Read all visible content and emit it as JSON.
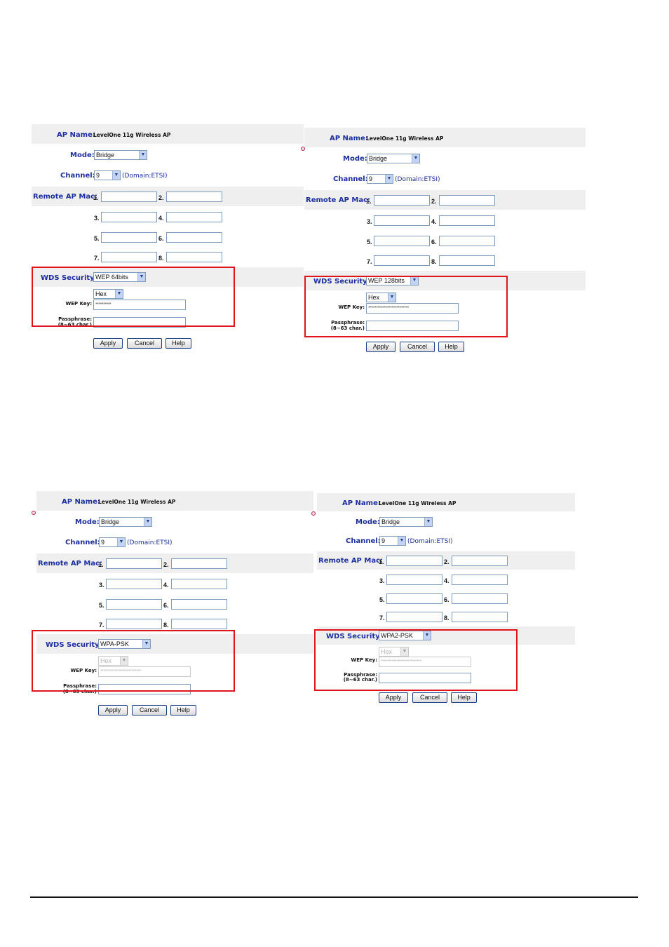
{
  "panels": [
    {
      "ap_name_label": "AP Name:",
      "ap_name": "LevelOne 11g Wireless AP",
      "mode_label": "Mode:",
      "mode": "Bridge",
      "channel_label": "Channel:",
      "channel": "9",
      "domain": "(Domain:ETSI)",
      "remote_label": "Remote AP Mac:",
      "mac_numbers": [
        "1.",
        "2.",
        "3.",
        "4.",
        "5.",
        "6.",
        "7.",
        "8."
      ],
      "security_label": "WDS Security:",
      "security": "WEP 64bits",
      "key_format": "Hex",
      "wep_key_label": "WEP Key:",
      "wep_key": "**********",
      "passphrase_label": "Passphrase:",
      "passphrase_hint": "(8~63 char.)",
      "apply": "Apply",
      "cancel": "Cancel",
      "help": "Help"
    },
    {
      "ap_name_label": "AP Name:",
      "ap_name": "LevelOne 11g Wireless AP",
      "mode_label": "Mode:",
      "mode": "Bridge",
      "channel_label": "Channel:",
      "channel": "9",
      "domain": "(Domain:ETSI)",
      "remote_label": "Remote AP Mac:",
      "mac_numbers": [
        "1.",
        "2.",
        "3.",
        "4.",
        "5.",
        "6.",
        "7.",
        "8."
      ],
      "security_label": "WDS Security:",
      "security": "WEP 128bits",
      "key_format": "Hex",
      "wep_key_label": "WEP Key:",
      "wep_key": "**************************",
      "passphrase_label": "Passphrase:",
      "passphrase_hint": "(8~63 char.)",
      "apply": "Apply",
      "cancel": "Cancel",
      "help": "Help"
    },
    {
      "ap_name_label": "AP Name:",
      "ap_name": "LevelOne 11g Wireless AP",
      "mode_label": "Mode:",
      "mode": "Bridge",
      "channel_label": "Channel:",
      "channel": "9",
      "domain": "(Domain:ETSI)",
      "remote_label": "Remote AP Mac:",
      "mac_numbers": [
        "1.",
        "2.",
        "3.",
        "4.",
        "5.",
        "6.",
        "7.",
        "8."
      ],
      "security_label": "WDS Security:",
      "security": "WPA-PSK",
      "key_format": "Hex",
      "wep_key_label": "WEP Key:",
      "wep_key": "**************************",
      "passphrase_label": "Passphrase:",
      "passphrase_hint": "(8~63 char.)",
      "apply": "Apply",
      "cancel": "Cancel",
      "help": "Help"
    },
    {
      "ap_name_label": "AP Name:",
      "ap_name": "LevelOne 11g Wireless AP",
      "mode_label": "Mode:",
      "mode": "Bridge",
      "channel_label": "Channel:",
      "channel": "9",
      "domain": "(Domain:ETSI)",
      "remote_label": "Remote AP Mac:",
      "mac_numbers": [
        "1.",
        "2.",
        "3.",
        "4.",
        "5.",
        "6.",
        "7.",
        "8."
      ],
      "security_label": "WDS Security:",
      "security": "WPA2-PSK",
      "key_format": "Hex",
      "wep_key_label": "WEP Key:",
      "wep_key": "**************************",
      "passphrase_label": "Passphrase:",
      "passphrase_hint": "(8~63 char.)",
      "apply": "Apply",
      "cancel": "Cancel",
      "help": "Help"
    }
  ],
  "colors": {
    "label": "#1d2f9e",
    "band": "#efefef",
    "highlight": "#e0141b"
  },
  "icons": {
    "dropdown": "chevron-down-icon",
    "marker": "bullet-icon"
  }
}
